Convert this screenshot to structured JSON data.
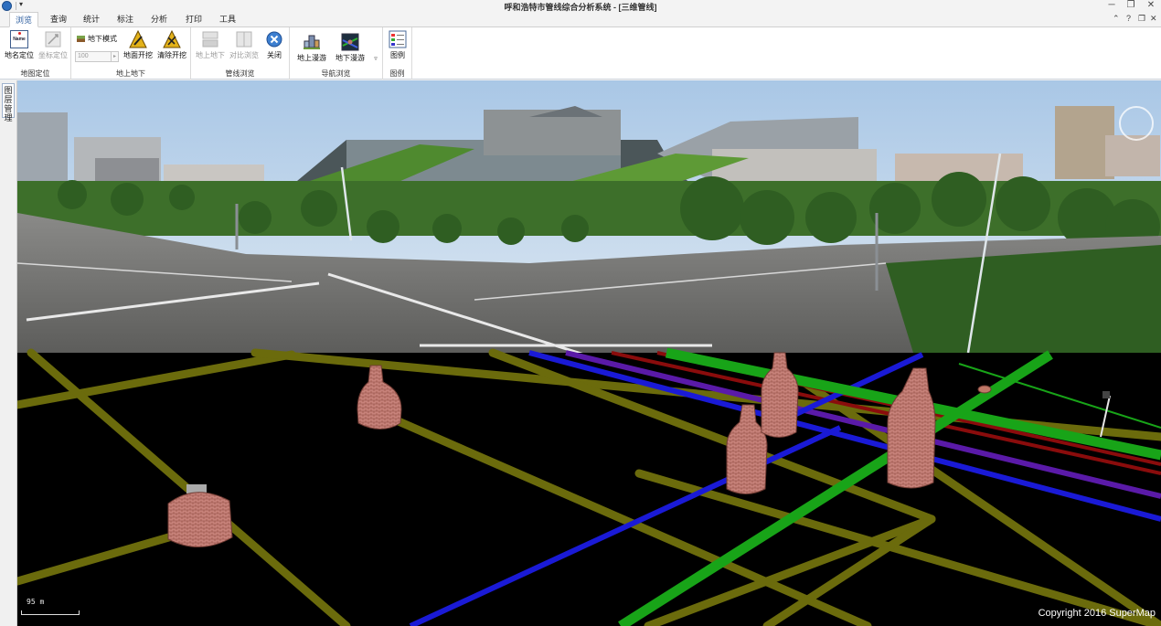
{
  "window": {
    "title": "呼和浩特市管线综合分析系统 - [三维管线]",
    "qat_dropdown": "▾",
    "controls": {
      "minimize": "─",
      "restore": "❐",
      "close": "✕"
    },
    "ribbon_controls": {
      "collapse": "⌃",
      "help": "?",
      "restore": "❐",
      "close": "✕"
    }
  },
  "tabs": [
    {
      "label": "浏览",
      "active": true
    },
    {
      "label": "查询",
      "active": false
    },
    {
      "label": "统计",
      "active": false
    },
    {
      "label": "标注",
      "active": false
    },
    {
      "label": "分析",
      "active": false
    },
    {
      "label": "打印",
      "active": false
    },
    {
      "label": "工具",
      "active": false
    }
  ],
  "ribbon": {
    "groups": [
      {
        "label": "地图定位",
        "buttons": [
          {
            "label": "地名定位",
            "icon_text": "Name",
            "enabled": true
          },
          {
            "label": "坐标定位",
            "enabled": false
          }
        ]
      },
      {
        "label": "地上地下",
        "mode_label": "地下模式",
        "spin_value": "100",
        "spin_arrow": "▸",
        "buttons": [
          {
            "label": "地面开挖",
            "enabled": true
          },
          {
            "label": "清除开挖",
            "enabled": true
          }
        ]
      },
      {
        "label": "管线浏览",
        "buttons": [
          {
            "label": "地上地下",
            "enabled": false
          },
          {
            "label": "对比浏览",
            "enabled": false
          },
          {
            "label": "关闭",
            "enabled": true
          }
        ]
      },
      {
        "label": "导航浏览",
        "buttons": [
          {
            "label": "地上漫游",
            "enabled": true
          },
          {
            "label": "地下漫游",
            "enabled": true
          }
        ],
        "more": "▿"
      },
      {
        "label": "图例",
        "buttons": [
          {
            "label": "图例",
            "enabled": true
          }
        ]
      }
    ]
  },
  "dock": {
    "tab_label": "图层管理"
  },
  "viewport": {
    "scale_label": "95 m",
    "copyright": "Copyright 2016 SuperMap"
  },
  "colors": {
    "pipe_olive": "#6b6b0c",
    "pipe_green": "#18a418",
    "pipe_blue": "#1a1ad6",
    "pipe_purple": "#5a1aa8",
    "pipe_red": "#8a0c0c",
    "manhole": "#c07868",
    "sky": "#b9d3ea"
  }
}
